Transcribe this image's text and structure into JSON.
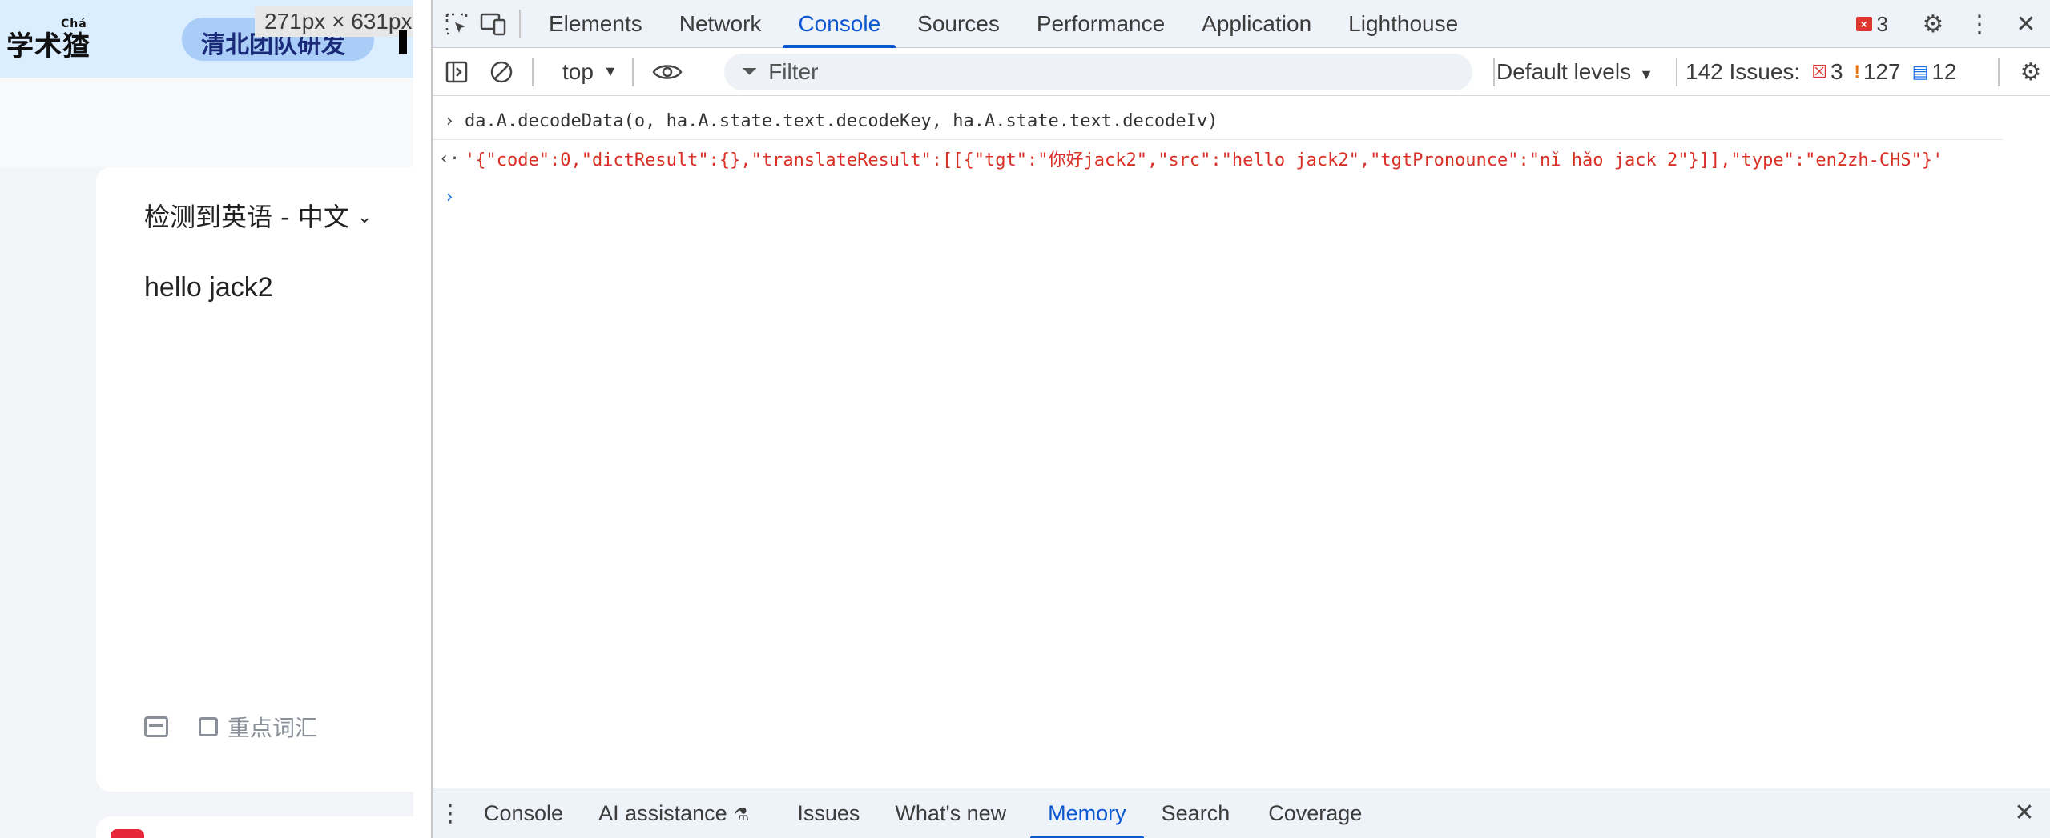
{
  "page": {
    "logo": "学术猹",
    "logo_ruby": "Chá",
    "pill_label": "清北团队研发",
    "dimension_badge": "271px × 631px",
    "language_pair": "检测到英语 - 中文",
    "source_text": "hello jack2",
    "keyword_toggle": "重点词汇"
  },
  "devtools": {
    "main_tabs": [
      "Elements",
      "Network",
      "Console",
      "Sources",
      "Performance",
      "Application",
      "Lighthouse"
    ],
    "active_main_tab": "Console",
    "error_count": "3",
    "toolbar": {
      "context": "top",
      "filter_placeholder": "Filter",
      "levels": "Default levels",
      "issues_label": "142 Issues:",
      "issues_errors": "3",
      "issues_warnings": "127",
      "issues_info": "12"
    },
    "console": {
      "input_expr": "da.A.decodeData(o, ha.A.state.text.decodeKey, ha.A.state.text.decodeIv)",
      "output_value": "'{\"code\":0,\"dictResult\":{},\"translateResult\":[[{\"tgt\":\"你好jack2\",\"src\":\"hello jack2\",\"tgtPronounce\":\"nǐ hǎo jack 2\"}]],\"type\":\"en2zh-CHS\"}'"
    },
    "drawer_tabs": [
      "Console",
      "AI assistance",
      "Issues",
      "What's new",
      "Memory",
      "Search",
      "Coverage"
    ],
    "active_drawer_tab": "Memory"
  },
  "colors": {
    "accent": "#0b57d0",
    "error": "#dc362e",
    "warning": "#e8710a",
    "info": "#1a73e8"
  }
}
